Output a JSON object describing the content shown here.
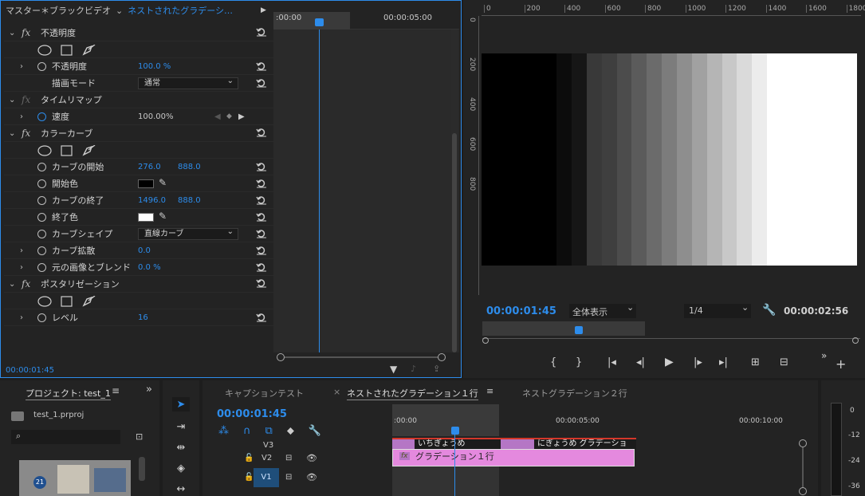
{
  "effect_controls": {
    "source_label": "マスター＊ブラックビデオ",
    "clip_tab": "ネストされたグラデーシ…",
    "ruler_start": ":00:00",
    "ruler_end": "00:00:05:00",
    "footer_time": "00:00:01:45",
    "sections": {
      "opacity": {
        "name": "不透明度",
        "prop_label": "不透明度",
        "prop_value": "100.0 %",
        "blend_label": "描画モード",
        "blend_value": "通常"
      },
      "timeremap": {
        "name": "タイムリマップ",
        "speed_label": "速度",
        "speed_value": "100.00%"
      },
      "curves": {
        "name": "カラーカーブ",
        "start_label": "カーブの開始",
        "start_x": "276.0",
        "start_y": "888.0",
        "start_color_label": "開始色",
        "start_color": "#000000",
        "end_label": "カーブの終了",
        "end_x": "1496.0",
        "end_y": "888.0",
        "end_color_label": "終了色",
        "end_color": "#ffffff",
        "shape_label": "カーブシェイプ",
        "shape_value": "直線カーブ",
        "diffuse_label": "カーブ拡散",
        "diffuse_value": "0.0",
        "blend_label": "元の画像とブレンド",
        "blend_value": "0.0 %"
      },
      "posterize": {
        "name": "ポスタリゼーション",
        "level_label": "レベル",
        "level_value": "16"
      }
    }
  },
  "program": {
    "ruler_labels": [
      "0",
      "200",
      "400",
      "600",
      "800",
      "1000",
      "1200",
      "1400",
      "1600",
      "1800"
    ],
    "vruler_labels": [
      "0",
      "200",
      "400",
      "600",
      "800"
    ],
    "timecode": "00:00:01:45",
    "fit": "全体表示",
    "resolution": "1/4",
    "duration": "00:00:02:56",
    "gradient_steps": [
      "#000000",
      "#000000",
      "#000000",
      "#000000",
      "#000000",
      "#0c0c0c",
      "#161616",
      "#393939",
      "#3f3f3f",
      "#4c4c4c",
      "#5b5b5b",
      "#6b6b6b",
      "#7c7c7c",
      "#8e8e8e",
      "#a1a1a1",
      "#b5b5b5",
      "#c8c8c8",
      "#dadada",
      "#ececec",
      "#ffffff",
      "#ffffff",
      "#ffffff",
      "#ffffff",
      "#ffffff",
      "#ffffff"
    ]
  },
  "project": {
    "tab": "プロジェクト: test_1",
    "file": "test_1.prproj"
  },
  "timeline": {
    "tabs": [
      "キャプションテスト",
      "ネストされたグラデーション１行",
      "ネストグラデーション２行"
    ],
    "timecode": "00:00:01:45",
    "ruler": [
      ":00:00",
      "00:00:05:00",
      "00:00:10:00"
    ],
    "tracks": [
      "V3",
      "V2",
      "V1"
    ],
    "caption_1": "いちぎょうめ",
    "caption_2": "にぎょうめ グラデーショ",
    "clip": "グラデーション１行"
  },
  "meter": {
    "labels": [
      "0",
      "-12",
      "-24",
      "-36"
    ]
  }
}
